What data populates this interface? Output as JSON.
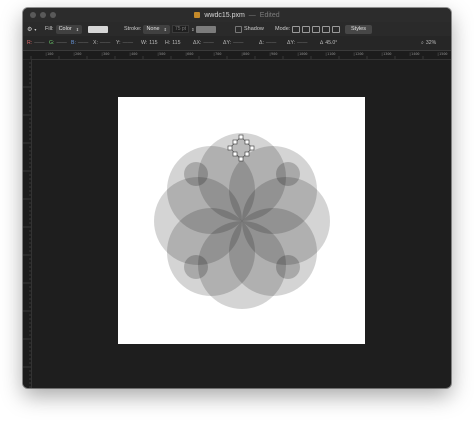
{
  "window": {
    "title": "wwdc15.pxm",
    "separator": "—",
    "status": "Edited"
  },
  "toolbar": {
    "fill_label": "Fill:",
    "fill_type": "Color",
    "stroke_label": "Stroke:",
    "stroke_type": "None",
    "stroke_width": "75 pt",
    "shadow_label": "Shadow",
    "mode_label": "Mode:",
    "styles_button": "Styles"
  },
  "inspector": {
    "r_label": "R:",
    "r_value": "——",
    "g_label": "G:",
    "g_value": "——",
    "b_label": "B:",
    "b_value": "——",
    "x_label": "X:",
    "x_value": "——",
    "y_label": "Y:",
    "y_value": "——",
    "w_label": "W:",
    "w_value": "115",
    "h_label": "H:",
    "h_value": "115",
    "dx_label": "ΔX:",
    "dx_value": "——",
    "dy_label": "ΔY:",
    "dy_value": "——",
    "angle_label": "Δ:",
    "angle_value": "——",
    "dist_label": "ΔY:",
    "dist_value": "——",
    "rotation_label": "∆",
    "rotation_value": "45.0°",
    "zoom_value": "32%"
  },
  "ruler": {
    "labels": [
      "|100",
      "|200",
      "|300",
      "|400",
      "|500",
      "|600",
      "|700",
      "|800",
      "|900",
      "|1000",
      "|1100",
      "|1200",
      "|1300",
      "|1400",
      "|1500"
    ]
  },
  "colors": {
    "accent_dark": "#1e1e1e",
    "canvas": "#ffffff",
    "shape_gray": "#7a7a7a"
  },
  "icons": [
    "gear-icon",
    "fill-swatch",
    "mode-icons",
    "zoom-icon"
  ]
}
